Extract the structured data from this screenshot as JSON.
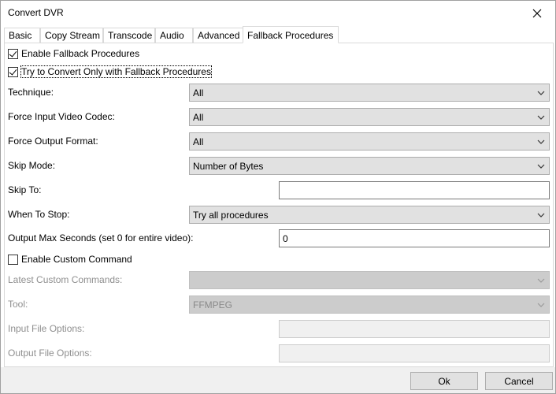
{
  "window": {
    "title": "Convert DVR"
  },
  "tabs": [
    {
      "label": "Basic"
    },
    {
      "label": "Copy Stream"
    },
    {
      "label": "Transcode"
    },
    {
      "label": "Audio"
    },
    {
      "label": "Advanced"
    },
    {
      "label": "Fallback Procedures",
      "active": true
    }
  ],
  "form": {
    "enable_fallback": {
      "label": "Enable Fallback Procedures",
      "checked": true
    },
    "try_only_fallback": {
      "label": "Try to Convert Only with Fallback Procedures",
      "checked": true
    },
    "technique": {
      "label": "Technique:",
      "value": "All"
    },
    "force_input_codec": {
      "label": "Force Input Video Codec:",
      "value": "All"
    },
    "force_output_format": {
      "label": "Force Output Format:",
      "value": "All"
    },
    "skip_mode": {
      "label": "Skip Mode:",
      "value": "Number of Bytes"
    },
    "skip_to": {
      "label": "Skip To:",
      "value": ""
    },
    "when_to_stop": {
      "label": "When To Stop:",
      "value": "Try all procedures"
    },
    "output_max_seconds": {
      "label": "Output Max Seconds (set 0 for entire video):",
      "value": "0"
    },
    "enable_custom_command": {
      "label": "Enable Custom Command",
      "checked": false
    },
    "latest_custom_commands": {
      "label": "Latest Custom Commands:",
      "value": ""
    },
    "tool": {
      "label": "Tool:",
      "value": "FFMPEG"
    },
    "input_file_options": {
      "label": "Input File Options:",
      "value": ""
    },
    "output_file_options": {
      "label": "Output File Options:",
      "value": ""
    }
  },
  "buttons": {
    "ok": "Ok",
    "cancel": "Cancel"
  },
  "icons": {
    "close": "close-icon",
    "dropdown": "chevron-down-icon"
  }
}
